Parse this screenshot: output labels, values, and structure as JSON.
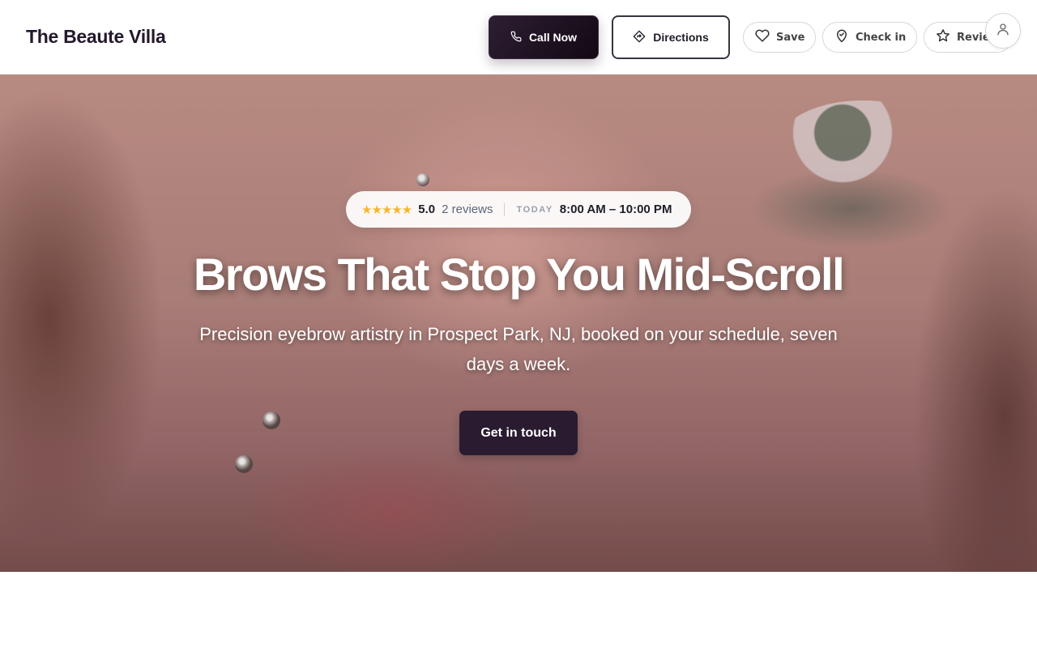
{
  "brand": {
    "name": "The Beaute Villa"
  },
  "header": {
    "call_label": "Call Now",
    "directions_label": "Directions",
    "save_label": "Save",
    "checkin_label": "Check in",
    "review_label": "Review"
  },
  "hero": {
    "stars": "★★★★★",
    "rating": "5.0",
    "reviews": "2 reviews",
    "today_label": "TODAY",
    "hours": "8:00 AM – 10:00 PM",
    "title": "Brows That Stop You Mid-Scroll",
    "subtitle": "Precision eyebrow artistry in Prospect Park, NJ, booked on your schedule, seven days a week.",
    "cta_label": "Get in touch"
  },
  "icons": {
    "phone": "phone-icon",
    "directions": "directions-icon",
    "heart": "heart-icon",
    "checkin": "map-pin-icon",
    "star": "star-icon",
    "user": "user-icon"
  },
  "colors": {
    "brand_dark": "#24182b",
    "cta": "#2a1b30",
    "star": "#f5b82e"
  }
}
